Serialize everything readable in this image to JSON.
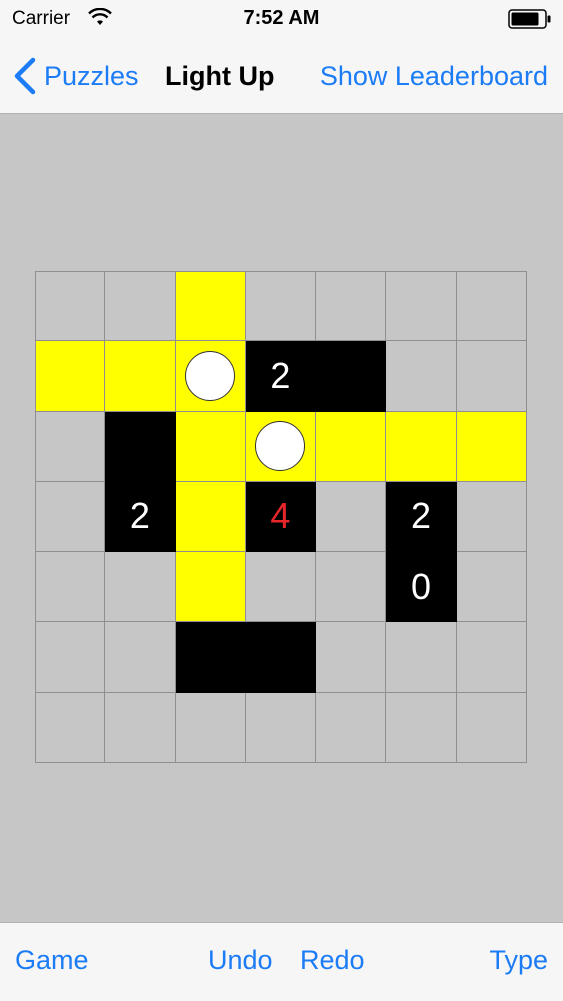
{
  "status_bar": {
    "carrier": "Carrier",
    "time": "7:52 AM"
  },
  "nav": {
    "back_label": "Puzzles",
    "title": "Light Up",
    "right_button": "Show Leaderboard"
  },
  "toolbar": {
    "game": "Game",
    "undo": "Undo",
    "redo": "Redo",
    "type": "Type"
  },
  "colors": {
    "accent": "#1b7cf5",
    "lit": "#ffff00",
    "wall": "#000000",
    "error": "#e8262a",
    "background": "#c6c6c6"
  },
  "board": {
    "rows": 7,
    "cols": 7,
    "grid": [
      [
        ".",
        ".",
        "L",
        ".",
        ".",
        ".",
        "."
      ],
      [
        "L",
        "L",
        "B",
        "2",
        "W",
        ".",
        "."
      ],
      [
        ".",
        "W",
        "L",
        "B",
        "L",
        "L",
        "L"
      ],
      [
        ".",
        "2",
        "L",
        "4!",
        ".",
        "2",
        "."
      ],
      [
        ".",
        ".",
        "L",
        ".",
        ".",
        "0",
        "."
      ],
      [
        ".",
        ".",
        "W",
        "W",
        ".",
        ".",
        "."
      ],
      [
        ".",
        ".",
        ".",
        ".",
        ".",
        ".",
        "."
      ]
    ]
  }
}
